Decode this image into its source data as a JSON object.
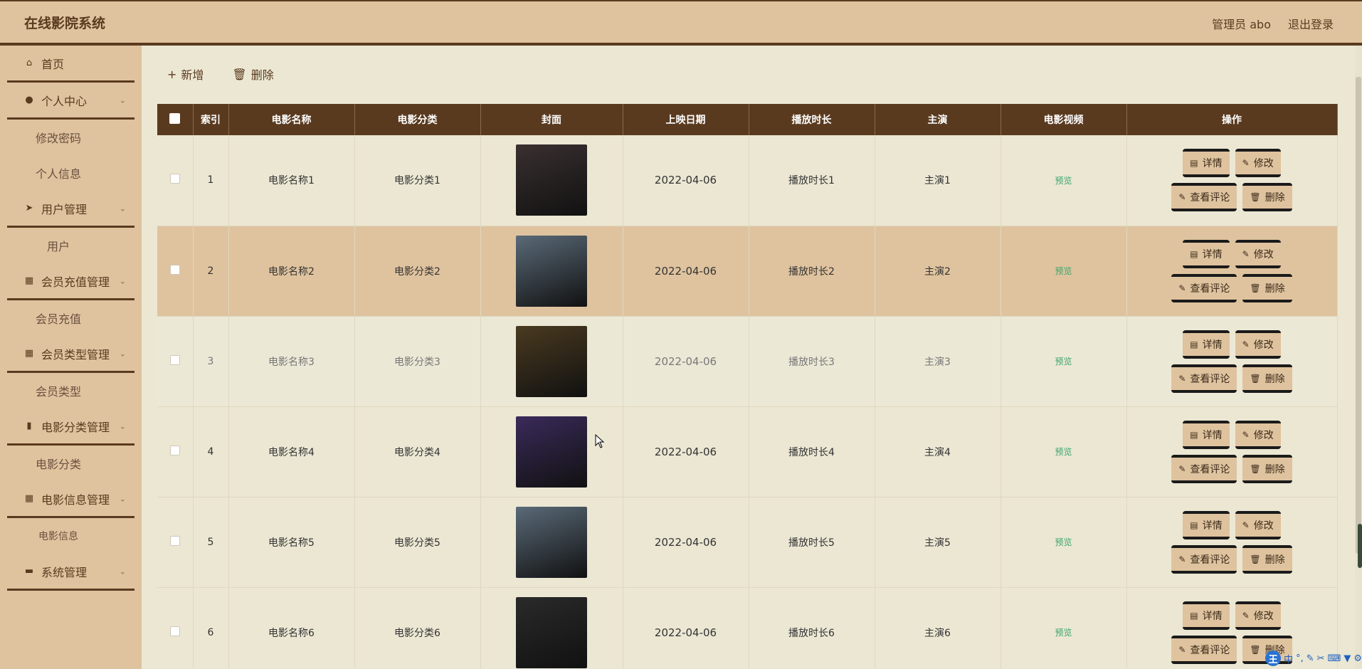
{
  "header": {
    "brand": "在线影院系统",
    "user_label": "管理员 abo",
    "logout": "退出登录"
  },
  "sidebar": {
    "items": [
      {
        "label": "首页",
        "icon": "home-icon"
      },
      {
        "label": "个人中心",
        "icon": "user-icon",
        "sub": [
          "修改密码",
          "个人信息"
        ]
      },
      {
        "label": "用户管理",
        "icon": "send-icon",
        "sub": [
          "用户"
        ]
      },
      {
        "label": "会员充值管理",
        "icon": "grid-icon",
        "sub": [
          "会员充值"
        ]
      },
      {
        "label": "会员类型管理",
        "icon": "grid-icon",
        "sub": [
          "会员类型"
        ]
      },
      {
        "label": "电影分类管理",
        "icon": "chart-icon",
        "sub": [
          "电影分类"
        ]
      },
      {
        "label": "电影信息管理",
        "icon": "grid-icon",
        "sub": [
          "电影信息"
        ]
      },
      {
        "label": "系统管理",
        "icon": "monitor-icon",
        "sub": []
      }
    ]
  },
  "toolbar": {
    "add_label": "新增",
    "delete_label": "删除"
  },
  "table": {
    "headers": [
      "索引",
      "电影名称",
      "电影分类",
      "封面",
      "上映日期",
      "播放时长",
      "主演",
      "电影视频",
      "操作"
    ],
    "rows": [
      {
        "index": "1",
        "name": "电影名称1",
        "category": "电影分类1",
        "date": "2022-04-06",
        "duration": "播放时长1",
        "actor": "主演1",
        "video": "预览",
        "cover_color": "#3a3030"
      },
      {
        "index": "2",
        "name": "电影名称2",
        "category": "电影分类2",
        "date": "2022-04-06",
        "duration": "播放时长2",
        "actor": "主演2",
        "video": "预览",
        "cover_color": "#5a6a78"
      },
      {
        "index": "3",
        "name": "电影名称3",
        "category": "电影分类3",
        "date": "2022-04-06",
        "duration": "播放时长3",
        "actor": "主演3",
        "video": "预览",
        "cover_color": "#4a3a20"
      },
      {
        "index": "4",
        "name": "电影名称4",
        "category": "电影分类4",
        "date": "2022-04-06",
        "duration": "播放时长4",
        "actor": "主演4",
        "video": "预览",
        "cover_color": "#3a2a5a"
      },
      {
        "index": "5",
        "name": "电影名称5",
        "category": "电影分类5",
        "date": "2022-04-06",
        "duration": "播放时长5",
        "actor": "主演5",
        "video": "预览",
        "cover_color": "#5a6a78"
      },
      {
        "index": "6",
        "name": "电影名称6",
        "category": "电影分类6",
        "date": "2022-04-06",
        "duration": "播放时长6",
        "actor": "主演6",
        "video": "预览",
        "cover_color": "#2a2a2a"
      }
    ],
    "ops": {
      "detail": "详情",
      "edit": "修改",
      "comments": "查看评论",
      "delete": "删除"
    }
  },
  "ime": {
    "label": "中"
  },
  "colors": {
    "accent": "#5a3a1f",
    "header_bg": "#dfc39e",
    "body_bg": "#ebe7d3",
    "preview_green": "#3aa56b"
  }
}
